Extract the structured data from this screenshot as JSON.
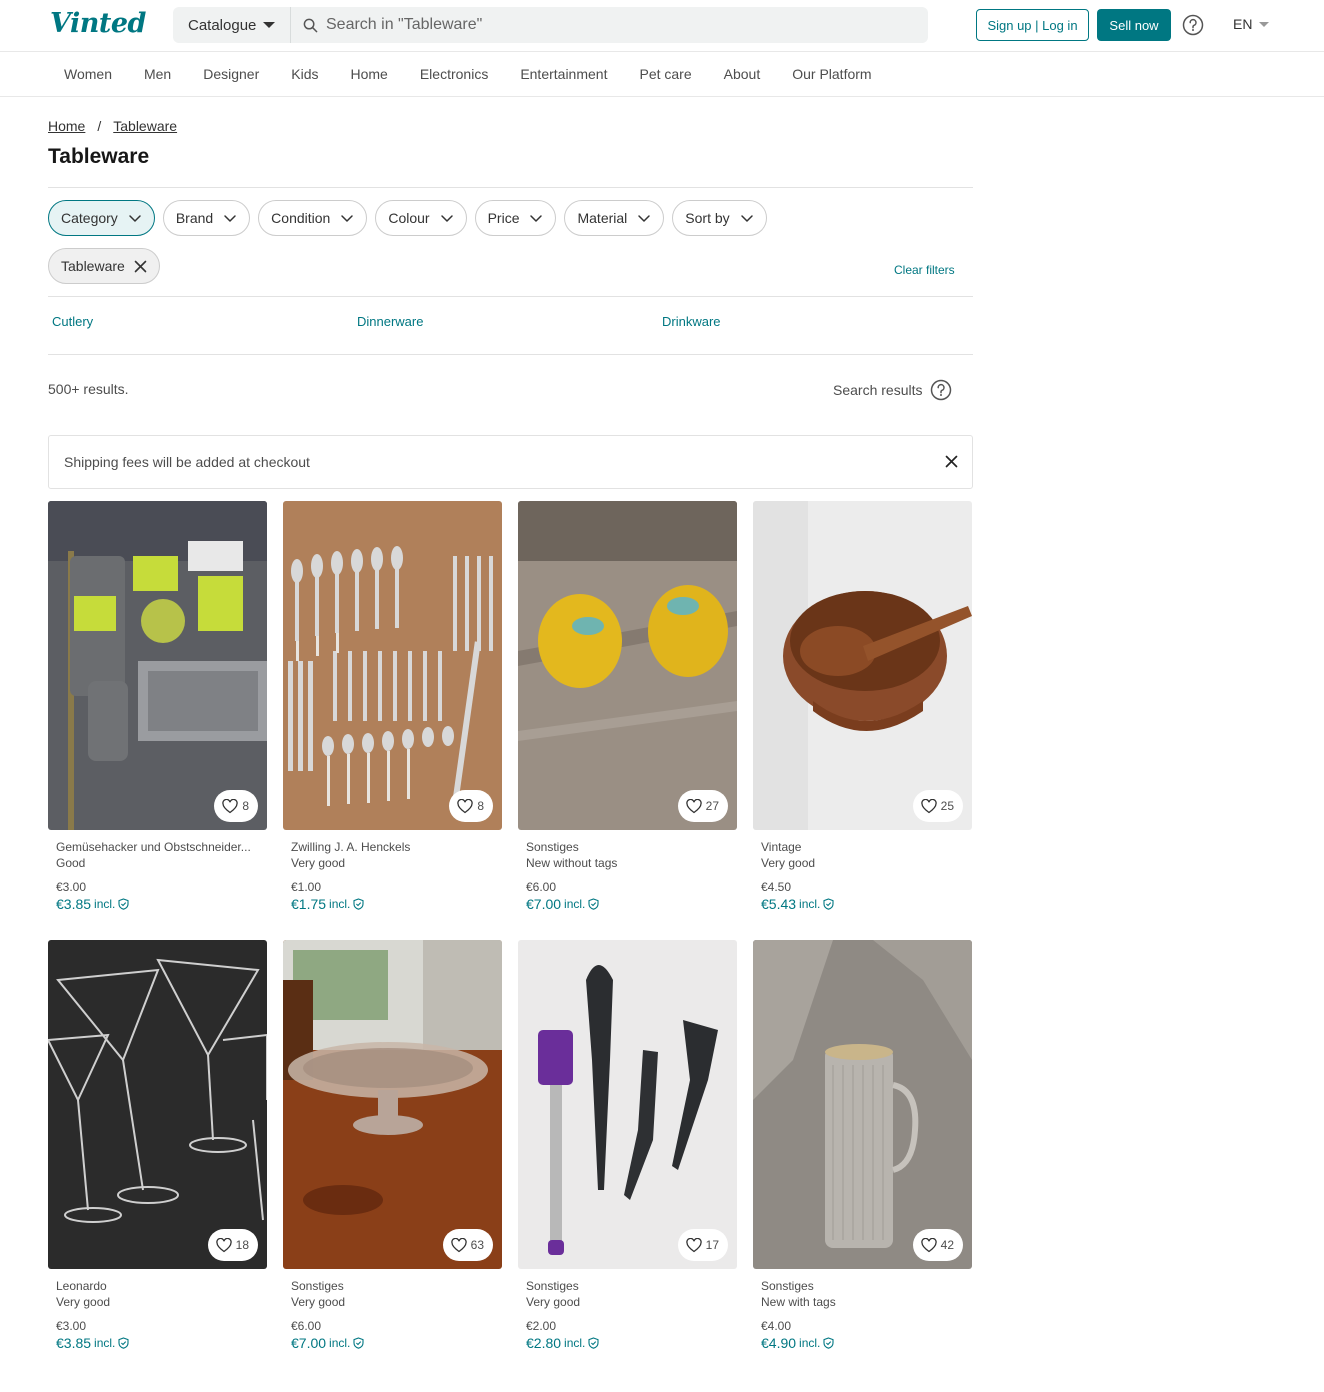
{
  "header": {
    "logo": "Vinted",
    "catalogue_label": "Catalogue",
    "search_placeholder": "Search in \"Tableware\"",
    "signup_label": "Sign up | Log in",
    "sell_label": "Sell now",
    "language": "EN"
  },
  "nav": [
    "Women",
    "Men",
    "Designer",
    "Kids",
    "Home",
    "Electronics",
    "Entertainment",
    "Pet care",
    "About",
    "Our Platform"
  ],
  "breadcrumb": {
    "home": "Home",
    "sep": "/",
    "current": "Tableware"
  },
  "page_title": "Tableware",
  "filters": [
    "Category",
    "Brand",
    "Condition",
    "Colour",
    "Price",
    "Material",
    "Sort by"
  ],
  "active_filter": "Tableware",
  "clear_filters": "Clear filters",
  "subcategories": [
    "Cutlery",
    "Dinnerware",
    "Drinkware"
  ],
  "results_count": "500+ results.",
  "search_results_label": "Search results",
  "shipping_notice": "Shipping fees will be added at checkout",
  "items": [
    {
      "brand": "Gemüsehacker und Obstschneider...",
      "condition": "Good",
      "price": "€3.00",
      "total": "€3.85",
      "incl": "incl.",
      "favourites": "8"
    },
    {
      "brand": "Zwilling J. A. Henckels",
      "condition": "Very good",
      "price": "€1.00",
      "total": "€1.75",
      "incl": "incl.",
      "favourites": "8"
    },
    {
      "brand": "Sonstiges",
      "condition": "New without tags",
      "price": "€6.00",
      "total": "€7.00",
      "incl": "incl.",
      "favourites": "27"
    },
    {
      "brand": "Vintage",
      "condition": "Very good",
      "price": "€4.50",
      "total": "€5.43",
      "incl": "incl.",
      "favourites": "25"
    },
    {
      "brand": "Leonardo",
      "condition": "Very good",
      "price": "€3.00",
      "total": "€3.85",
      "incl": "incl.",
      "favourites": "18"
    },
    {
      "brand": "Sonstiges",
      "condition": "Very good",
      "price": "€6.00",
      "total": "€7.00",
      "incl": "incl.",
      "favourites": "63"
    },
    {
      "brand": "Sonstiges",
      "condition": "Very good",
      "price": "€2.00",
      "total": "€2.80",
      "incl": "incl.",
      "favourites": "17"
    },
    {
      "brand": "Sonstiges",
      "condition": "New with tags",
      "price": "€4.00",
      "total": "€4.90",
      "incl": "incl.",
      "favourites": "42"
    }
  ],
  "colors": {
    "brand": "#007782",
    "chip_active_bg": "#e6f3f4"
  }
}
